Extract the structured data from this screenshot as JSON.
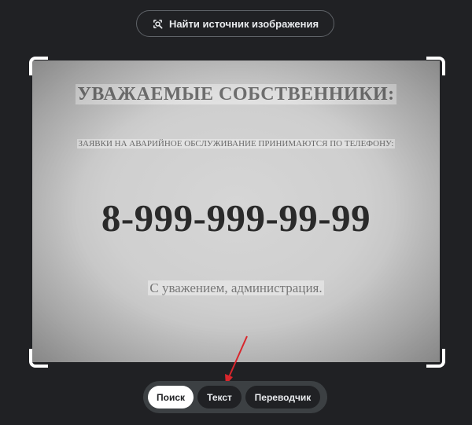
{
  "header": {
    "find_source_label": "Найти источник изображения"
  },
  "image": {
    "heading": "УВАЖАЕМЫЕ СОБСТВЕННИКИ:",
    "subline": "ЗАЯВКИ НА АВАРИЙНОЕ ОБСЛУЖИВАНИЕ ПРИНИМАЮТСЯ ПО ТЕЛЕФОНУ:",
    "phone": "8-999-999-99-99",
    "signature": "С уважением, администрация."
  },
  "tabs": [
    {
      "label": "Поиск",
      "active": true
    },
    {
      "label": "Текст",
      "active": false
    },
    {
      "label": "Переводчик",
      "active": false
    }
  ],
  "colors": {
    "background": "#202124",
    "annotation_arrow": "#d9262c",
    "tab_active_bg": "#ffffff"
  },
  "icons": {
    "find_source": "lens-search-icon"
  }
}
